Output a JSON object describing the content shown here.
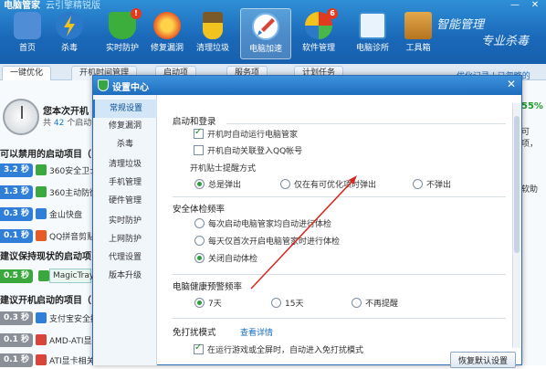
{
  "app": {
    "title": "电脑管家",
    "version": "云引擎精锐版"
  },
  "window_controls": [
    "—",
    "✕"
  ],
  "slogan": [
    "智能管理",
    "专业杀毒"
  ],
  "toolbar": [
    {
      "label": "首页",
      "icon": "monitor-icon",
      "color": "#4f8dd6"
    },
    {
      "label": "杀毒",
      "icon": "lightning-icon",
      "color": "#f2b41c"
    },
    {
      "label": "实时防护",
      "icon": "shield-check-icon",
      "color": "#3cae3c",
      "badge": "!"
    },
    {
      "label": "修复漏洞",
      "icon": "repair-icon",
      "color": "#e85a24"
    },
    {
      "label": "清理垃圾",
      "icon": "broom-icon",
      "color": "#f2c21f"
    },
    {
      "label": "电脑加速",
      "icon": "rocket-icon",
      "color": "#d9443a",
      "active": true
    },
    {
      "label": "软件管理",
      "icon": "software-icon",
      "color": "#48b648",
      "badge": "6"
    },
    {
      "label": "电脑诊所",
      "icon": "stethoscope-icon",
      "color": "#3b8ed6"
    },
    {
      "label": "工具箱",
      "icon": "toolbox-icon",
      "color": "#c98a2b"
    }
  ],
  "tabs": [
    "一键优化",
    "开机时间管理",
    "启动项",
    "服务项",
    "计划任务"
  ],
  "top_right_link": "优化记录 | 已忽略的",
  "background": {
    "headline": "您本次开机",
    "sub_prefix": "共",
    "sub_count": "42",
    "sub_suffix": "个启动",
    "section1": "可以禁用的启动项目（",
    "section2": "建议保持现状的启动项",
    "section3": "建议开机启动的项目（",
    "rows_disable": [
      {
        "time": "3.2 秒",
        "name": "360安全卫士",
        "color": "#2f7ed8"
      },
      {
        "time": "1.3 秒",
        "name": "360主动防御",
        "color": "#2f7ed8"
      },
      {
        "time": "0.3 秒",
        "name": "金山快盘",
        "color": "#2f7ed8"
      },
      {
        "time": "0.1 秒",
        "name": "QQ拼音剪贴",
        "color": "#2f7ed8"
      }
    ],
    "rows_keep": [
      {
        "time": "0.5 秒",
        "name": "MagicTray",
        "color": "#3aa83e"
      }
    ],
    "rows_boot": [
      {
        "time": "0.3 秒",
        "name": "支付宝安全控",
        "color": "#8a8f98"
      },
      {
        "time": "0.1 秒",
        "name": "AMD-ATI显卡",
        "color": "#8a8f98"
      },
      {
        "time": "0.1 秒",
        "name": "ATI显卡相关",
        "color": "#8a8f98"
      }
    ],
    "right_info": [
      "55%",
      "可",
      "项，",
      "软助"
    ]
  },
  "dialog": {
    "title": "设置中心",
    "close": "✕",
    "sidebar": [
      "常规设置",
      "修复漏洞",
      "杀毒",
      "清理垃圾",
      "手机管理",
      "硬件管理",
      "实时防护",
      "上网防护",
      "代理设置",
      "版本升级"
    ],
    "groups": {
      "startup": {
        "title": "启动和登录",
        "auto_run": "开机时自动运行电脑管家",
        "auto_qq": "开机自动关联登入QQ帐号",
        "tips_title": "开机贴士提醒方式",
        "tips_options": [
          "总是弹出",
          "仅在有可优化项时弹出",
          "不弹出"
        ]
      },
      "security": {
        "title": "安全体检频率",
        "options": [
          "每次启动电脑管家均自动进行体检",
          "每天仅首次开启电脑管家时进行体检",
          "关闭自动体检"
        ]
      },
      "health": {
        "title": "电脑健康预警频率",
        "options": [
          "7天",
          "15天",
          "不再提醒"
        ]
      },
      "nodisturb": {
        "title": "免打扰模式",
        "details_link": "查看详情",
        "option": "在运行游戏或全屏时，自动进入免打扰模式"
      }
    },
    "restore_button": "恢复默认设置"
  }
}
